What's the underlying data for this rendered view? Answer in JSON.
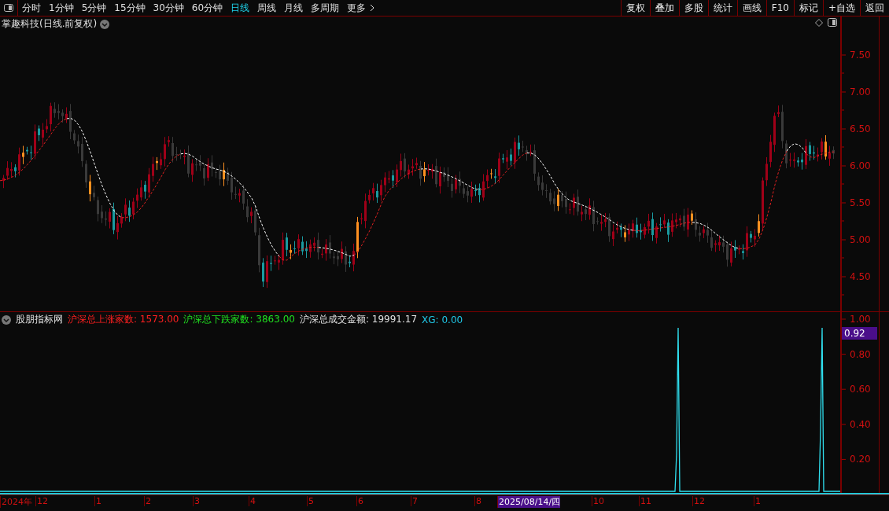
{
  "toolbar": {
    "periods": [
      {
        "label": "分时",
        "selected": false
      },
      {
        "label": "1分钟",
        "selected": false
      },
      {
        "label": "5分钟",
        "selected": false
      },
      {
        "label": "15分钟",
        "selected": false
      },
      {
        "label": "30分钟",
        "selected": false
      },
      {
        "label": "60分钟",
        "selected": false
      },
      {
        "label": "日线",
        "selected": true
      },
      {
        "label": "周线",
        "selected": false
      },
      {
        "label": "月线",
        "selected": false
      },
      {
        "label": "多周期",
        "selected": false
      },
      {
        "label": "更多",
        "selected": false
      }
    ],
    "buttons": [
      "复权",
      "叠加",
      "多股",
      "统计",
      "画线",
      "F10",
      "标记",
      "+自选",
      "返回"
    ]
  },
  "main_chart": {
    "title": "掌趣科技(日线.前复权)",
    "price_ticks": [
      "7.50",
      "7.00",
      "6.50",
      "6.00",
      "5.50",
      "5.00",
      "4.50"
    ]
  },
  "indicator": {
    "source": "股朋指标网",
    "readings": [
      {
        "label": "沪深总上涨家数: 1573.00",
        "color": "#ff2020"
      },
      {
        "label": "沪深总下跌家数: 3863.00",
        "color": "#20e020"
      },
      {
        "label": "沪深总成交金额: 19991.17",
        "color": "#e0e0e0"
      },
      {
        "label": "XG: 0.00",
        "color": "#20c8e8"
      }
    ],
    "ticks": [
      "1.00",
      "0.80",
      "0.60",
      "0.40",
      "0.20"
    ],
    "current_value": "0.92"
  },
  "date_axis": [
    {
      "label": "2024年",
      "selected": false
    },
    {
      "label": "12",
      "selected": false
    },
    {
      "label": "1",
      "selected": false
    },
    {
      "label": "2",
      "selected": false
    },
    {
      "label": "3",
      "selected": false
    },
    {
      "label": "4",
      "selected": false
    },
    {
      "label": "5",
      "selected": false
    },
    {
      "label": "6",
      "selected": false
    },
    {
      "label": "7",
      "selected": false
    },
    {
      "label": "8",
      "selected": false
    },
    {
      "label": "2025/08/14/四",
      "selected": true
    },
    {
      "label": "10",
      "selected": false
    },
    {
      "label": "11",
      "selected": false
    },
    {
      "label": "12",
      "selected": false
    },
    {
      "label": "1",
      "selected": false
    }
  ]
}
